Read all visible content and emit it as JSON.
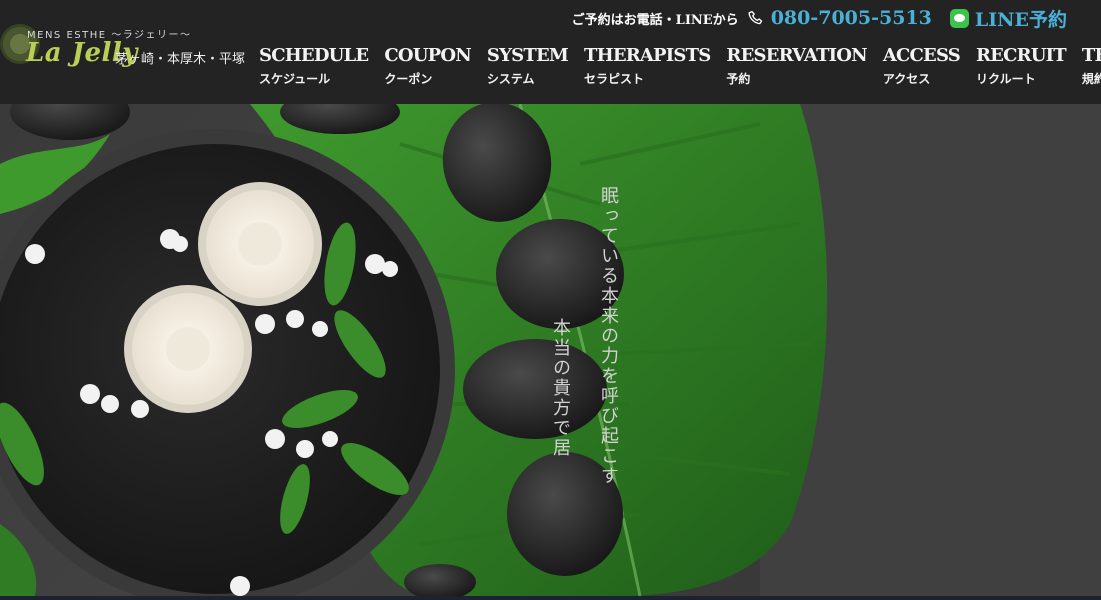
{
  "logo": {
    "small_text": "MENS ESTHE 〜ラジェリー〜",
    "script_text": "La Jelly",
    "areas": "茅ヶ崎・本厚木・平塚"
  },
  "contact": {
    "label": "ご予約はお電話・LINEから",
    "phone": "080-7005-5513",
    "line_label": "LINE予約",
    "link_color": "#4ab0d6",
    "line_green": "#3cc34c"
  },
  "nav": {
    "items": [
      {
        "en": "SCHEDULE",
        "jp": "スケジュール"
      },
      {
        "en": "COUPON",
        "jp": "クーポン"
      },
      {
        "en": "SYSTEM",
        "jp": "システム"
      },
      {
        "en": "THERAPISTS",
        "jp": "セラピスト"
      },
      {
        "en": "RESERVATION",
        "jp": "予約"
      },
      {
        "en": "ACCESS",
        "jp": "アクセス"
      },
      {
        "en": "RECRUIT",
        "jp": "リクルート"
      },
      {
        "en": "TERMS",
        "jp": "規約"
      }
    ]
  },
  "hero": {
    "tagline_1": "眠っている本来の力を呼び起こす",
    "tagline_2": "本当の貴方で居"
  }
}
